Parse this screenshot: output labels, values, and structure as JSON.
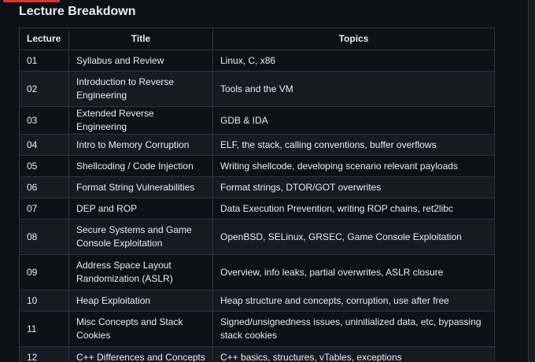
{
  "section": {
    "title": "Lecture Breakdown"
  },
  "table": {
    "headers": {
      "lecture": "Lecture",
      "title": "Title",
      "topics": "Topics"
    },
    "rows": [
      {
        "num": "01",
        "title": "Syllabus and Review",
        "topics": "Linux, C, x86"
      },
      {
        "num": "02",
        "title": "Introduction to Reverse Engineering",
        "topics": "Tools and the VM"
      },
      {
        "num": "03",
        "title": "Extended Reverse Engineering",
        "topics": "GDB & IDA"
      },
      {
        "num": "04",
        "title": "Intro to Memory Corruption",
        "topics": "ELF, the stack, calling conventions, buffer overflows"
      },
      {
        "num": "05",
        "title": "Shellcoding / Code Injection",
        "topics": "Writing shellcode, developing scenario relevant payloads"
      },
      {
        "num": "06",
        "title": "Format String Vulnerabilities",
        "topics": "Format strings, DTOR/GOT overwrites"
      },
      {
        "num": "07",
        "title": "DEP and ROP",
        "topics": "Data Execution Prevention, writing ROP chains, ret2libc"
      },
      {
        "num": "08",
        "title": "Secure Systems and Game Console Exploitation",
        "topics": "OpenBSD, SELinux, GRSEC, Game Console Exploitation"
      },
      {
        "num": "09",
        "title": "Address Space Layout Randomization (ASLR)",
        "topics": "Overview, info leaks, partial overwrites, ASLR closure"
      },
      {
        "num": "10",
        "title": "Heap Exploitation",
        "topics": "Heap structure and concepts, corruption, use after free"
      },
      {
        "num": "11",
        "title": "Misc Concepts and Stack Cookies",
        "topics": "Signed/unsignedness issues, uninitialized data, etc, bypassing stack cookies"
      },
      {
        "num": "12",
        "title": "C++ Differences and Concepts",
        "topics": "C++ basics, structures, vTables, exceptions"
      }
    ]
  },
  "colors": {
    "background": "#0d1117",
    "row_alt": "#161b22",
    "border": "#30363d",
    "text": "#e6edf3",
    "accent": "#da3633"
  }
}
